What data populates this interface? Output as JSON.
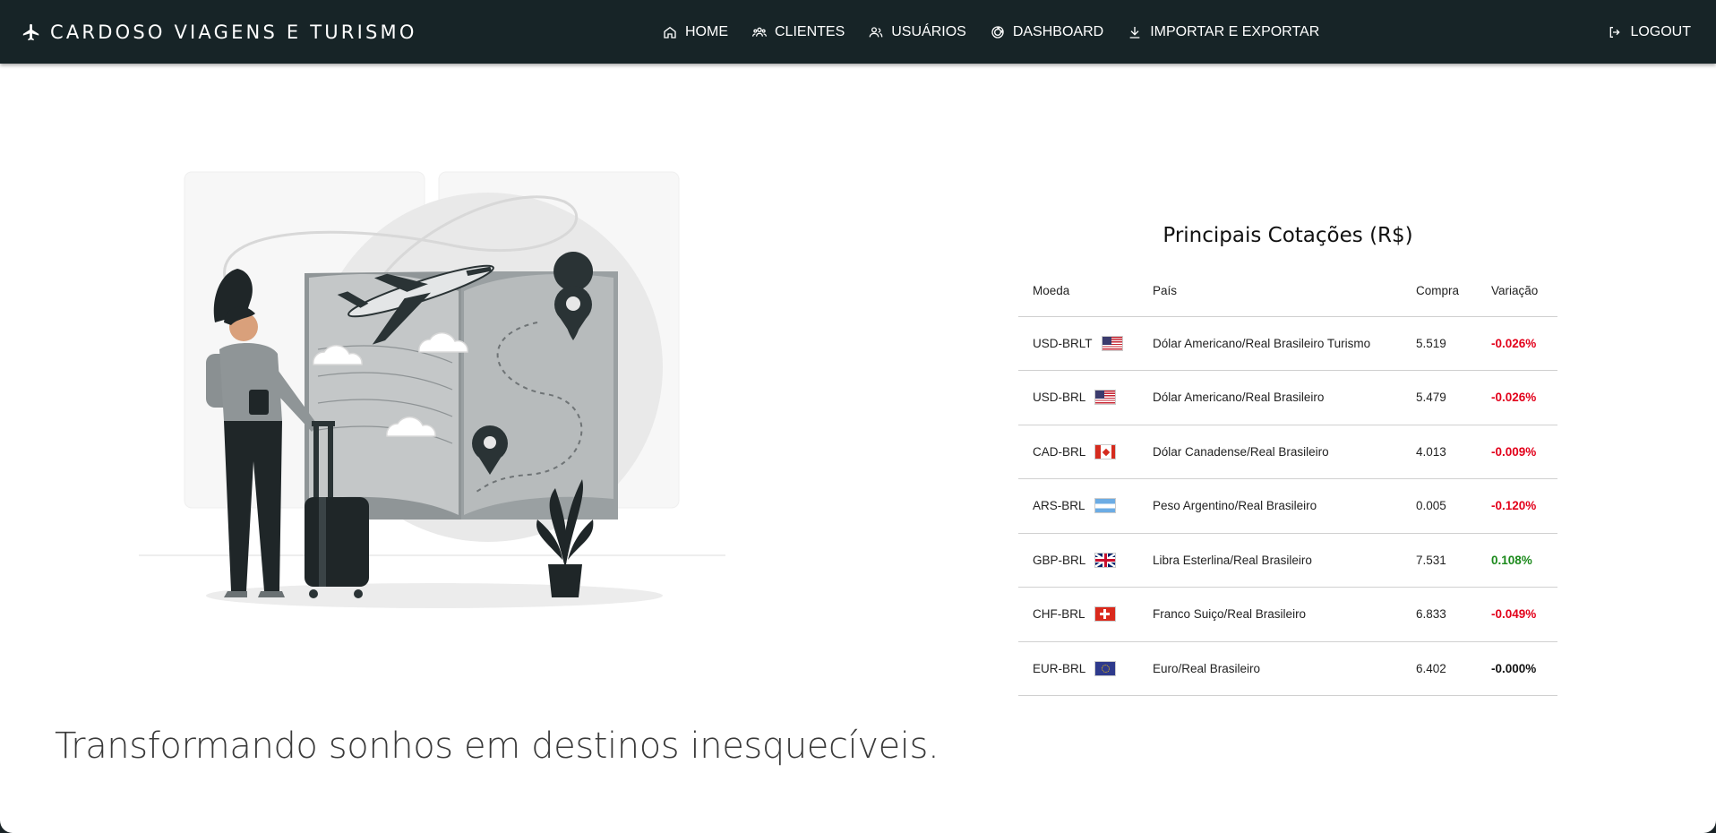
{
  "brand": {
    "name": "CARDOSO VIAGENS E TURISMO"
  },
  "nav": {
    "home": "HOME",
    "clientes": "CLIENTES",
    "usuarios": "USUÁRIOS",
    "dashboard": "DASHBOARD",
    "importar": "IMPORTAR E EXPORTAR",
    "logout": "LOGOUT"
  },
  "tagline": "Transformando sonhos em destinos inesquecíveis.",
  "quotes": {
    "title": "Principais Cotações (R$)",
    "headers": {
      "moeda": "Moeda",
      "pais": "País",
      "compra": "Compra",
      "variacao": "Variação"
    },
    "rows": [
      {
        "moeda": "USD-BRLT",
        "flag": "us-flag-icon",
        "pais": "Dólar Americano/Real Brasileiro Turismo",
        "compra": "5.519",
        "variacao": "-0.026%",
        "trend": "neg"
      },
      {
        "moeda": "USD-BRL",
        "flag": "us-flag-icon",
        "pais": "Dólar Americano/Real Brasileiro",
        "compra": "5.479",
        "variacao": "-0.026%",
        "trend": "neg"
      },
      {
        "moeda": "CAD-BRL",
        "flag": "ca-flag-icon",
        "pais": "Dólar Canadense/Real Brasileiro",
        "compra": "4.013",
        "variacao": "-0.009%",
        "trend": "neg"
      },
      {
        "moeda": "ARS-BRL",
        "flag": "ar-flag-icon",
        "pais": "Peso Argentino/Real Brasileiro",
        "compra": "0.005",
        "variacao": "-0.120%",
        "trend": "neg"
      },
      {
        "moeda": "GBP-BRL",
        "flag": "gb-flag-icon",
        "pais": "Libra Esterlina/Real Brasileiro",
        "compra": "7.531",
        "variacao": "0.108%",
        "trend": "pos"
      },
      {
        "moeda": "CHF-BRL",
        "flag": "ch-flag-icon",
        "pais": "Franco Suiço/Real Brasileiro",
        "compra": "6.833",
        "variacao": "-0.049%",
        "trend": "neg"
      },
      {
        "moeda": "EUR-BRL",
        "flag": "eu-flag-icon",
        "pais": "Euro/Real Brasileiro",
        "compra": "6.402",
        "variacao": "-0.000%",
        "trend": "zero"
      }
    ]
  },
  "colors": {
    "navbar": "#172427",
    "negative": "#e2001a",
    "positive": "#1c8a1c"
  }
}
